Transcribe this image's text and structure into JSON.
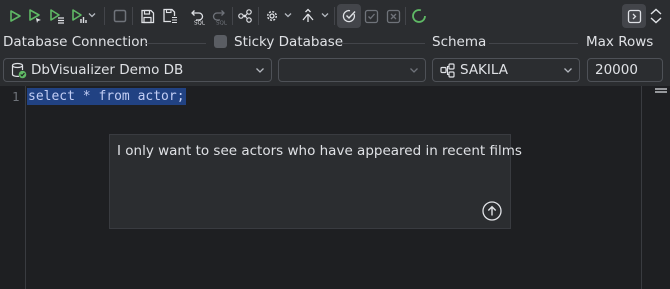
{
  "toolbar": {
    "icons": [
      "run-icon",
      "run-current-icon",
      "run-buffer-icon",
      "run-explain-icon",
      "stop-icon",
      "save-icon",
      "save-as-icon",
      "undo-sql-icon",
      "redo-sql-icon",
      "query-builder-icon",
      "settings-icon",
      "commit-icon",
      "auto-commit-icon",
      "commit-check-icon",
      "rollback-icon",
      "spinner-icon",
      "toggle-panel-icon",
      "collapse-icon"
    ]
  },
  "labels": {
    "database_connection": "Database Connection",
    "sticky_database": "Sticky Database",
    "schema": "Schema",
    "max_rows": "Max Rows"
  },
  "connection": {
    "selected": "DbVisualizer Demo DB"
  },
  "database": {
    "selected": ""
  },
  "schema": {
    "selected": "SAKILA"
  },
  "max_rows": {
    "value": "20000"
  },
  "editor": {
    "line_number": "1",
    "code": "select * from actor;"
  },
  "prompt": {
    "text": "I only want to see actors who have appeared in recent films"
  },
  "colors": {
    "accent_green": "#5fb865",
    "selection": "#214283",
    "background": "#2b2d30",
    "editor_bg": "#1e1f22"
  }
}
